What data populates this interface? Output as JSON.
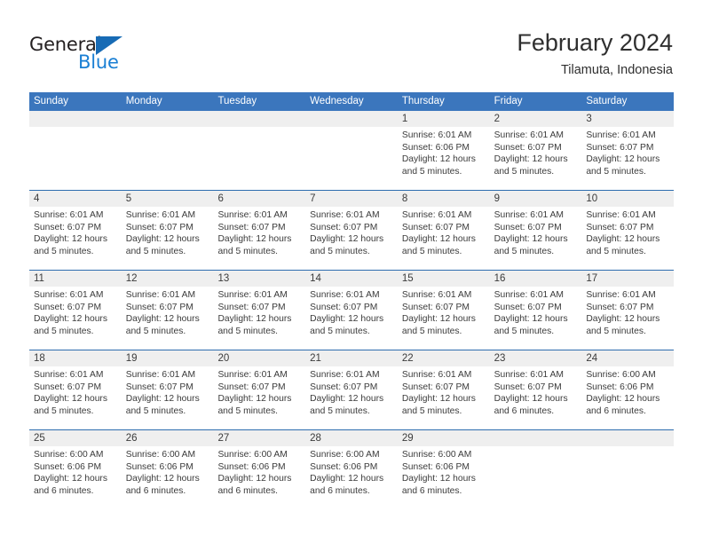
{
  "brand": {
    "name_part1": "General",
    "name_part2": "Blue"
  },
  "header": {
    "title": "February 2024",
    "subtitle": "Tilamuta, Indonesia"
  },
  "colors": {
    "header_blue": "#3b76bd",
    "separator_blue": "#2e6daf",
    "daynum_band": "#efefef",
    "logo_blue": "#1a7fd4",
    "text": "#3b3b3b"
  },
  "weekdays": [
    "Sunday",
    "Monday",
    "Tuesday",
    "Wednesday",
    "Thursday",
    "Friday",
    "Saturday"
  ],
  "weeks": [
    [
      {
        "day": "",
        "lines": [
          "",
          "",
          "",
          ""
        ]
      },
      {
        "day": "",
        "lines": [
          "",
          "",
          "",
          ""
        ]
      },
      {
        "day": "",
        "lines": [
          "",
          "",
          "",
          ""
        ]
      },
      {
        "day": "",
        "lines": [
          "",
          "",
          "",
          ""
        ]
      },
      {
        "day": "1",
        "lines": [
          "Sunrise: 6:01 AM",
          "Sunset: 6:06 PM",
          "Daylight: 12 hours",
          "and 5 minutes."
        ]
      },
      {
        "day": "2",
        "lines": [
          "Sunrise: 6:01 AM",
          "Sunset: 6:07 PM",
          "Daylight: 12 hours",
          "and 5 minutes."
        ]
      },
      {
        "day": "3",
        "lines": [
          "Sunrise: 6:01 AM",
          "Sunset: 6:07 PM",
          "Daylight: 12 hours",
          "and 5 minutes."
        ]
      }
    ],
    [
      {
        "day": "4",
        "lines": [
          "Sunrise: 6:01 AM",
          "Sunset: 6:07 PM",
          "Daylight: 12 hours",
          "and 5 minutes."
        ]
      },
      {
        "day": "5",
        "lines": [
          "Sunrise: 6:01 AM",
          "Sunset: 6:07 PM",
          "Daylight: 12 hours",
          "and 5 minutes."
        ]
      },
      {
        "day": "6",
        "lines": [
          "Sunrise: 6:01 AM",
          "Sunset: 6:07 PM",
          "Daylight: 12 hours",
          "and 5 minutes."
        ]
      },
      {
        "day": "7",
        "lines": [
          "Sunrise: 6:01 AM",
          "Sunset: 6:07 PM",
          "Daylight: 12 hours",
          "and 5 minutes."
        ]
      },
      {
        "day": "8",
        "lines": [
          "Sunrise: 6:01 AM",
          "Sunset: 6:07 PM",
          "Daylight: 12 hours",
          "and 5 minutes."
        ]
      },
      {
        "day": "9",
        "lines": [
          "Sunrise: 6:01 AM",
          "Sunset: 6:07 PM",
          "Daylight: 12 hours",
          "and 5 minutes."
        ]
      },
      {
        "day": "10",
        "lines": [
          "Sunrise: 6:01 AM",
          "Sunset: 6:07 PM",
          "Daylight: 12 hours",
          "and 5 minutes."
        ]
      }
    ],
    [
      {
        "day": "11",
        "lines": [
          "Sunrise: 6:01 AM",
          "Sunset: 6:07 PM",
          "Daylight: 12 hours",
          "and 5 minutes."
        ]
      },
      {
        "day": "12",
        "lines": [
          "Sunrise: 6:01 AM",
          "Sunset: 6:07 PM",
          "Daylight: 12 hours",
          "and 5 minutes."
        ]
      },
      {
        "day": "13",
        "lines": [
          "Sunrise: 6:01 AM",
          "Sunset: 6:07 PM",
          "Daylight: 12 hours",
          "and 5 minutes."
        ]
      },
      {
        "day": "14",
        "lines": [
          "Sunrise: 6:01 AM",
          "Sunset: 6:07 PM",
          "Daylight: 12 hours",
          "and 5 minutes."
        ]
      },
      {
        "day": "15",
        "lines": [
          "Sunrise: 6:01 AM",
          "Sunset: 6:07 PM",
          "Daylight: 12 hours",
          "and 5 minutes."
        ]
      },
      {
        "day": "16",
        "lines": [
          "Sunrise: 6:01 AM",
          "Sunset: 6:07 PM",
          "Daylight: 12 hours",
          "and 5 minutes."
        ]
      },
      {
        "day": "17",
        "lines": [
          "Sunrise: 6:01 AM",
          "Sunset: 6:07 PM",
          "Daylight: 12 hours",
          "and 5 minutes."
        ]
      }
    ],
    [
      {
        "day": "18",
        "lines": [
          "Sunrise: 6:01 AM",
          "Sunset: 6:07 PM",
          "Daylight: 12 hours",
          "and 5 minutes."
        ]
      },
      {
        "day": "19",
        "lines": [
          "Sunrise: 6:01 AM",
          "Sunset: 6:07 PM",
          "Daylight: 12 hours",
          "and 5 minutes."
        ]
      },
      {
        "day": "20",
        "lines": [
          "Sunrise: 6:01 AM",
          "Sunset: 6:07 PM",
          "Daylight: 12 hours",
          "and 5 minutes."
        ]
      },
      {
        "day": "21",
        "lines": [
          "Sunrise: 6:01 AM",
          "Sunset: 6:07 PM",
          "Daylight: 12 hours",
          "and 5 minutes."
        ]
      },
      {
        "day": "22",
        "lines": [
          "Sunrise: 6:01 AM",
          "Sunset: 6:07 PM",
          "Daylight: 12 hours",
          "and 5 minutes."
        ]
      },
      {
        "day": "23",
        "lines": [
          "Sunrise: 6:01 AM",
          "Sunset: 6:07 PM",
          "Daylight: 12 hours",
          "and 6 minutes."
        ]
      },
      {
        "day": "24",
        "lines": [
          "Sunrise: 6:00 AM",
          "Sunset: 6:06 PM",
          "Daylight: 12 hours",
          "and 6 minutes."
        ]
      }
    ],
    [
      {
        "day": "25",
        "lines": [
          "Sunrise: 6:00 AM",
          "Sunset: 6:06 PM",
          "Daylight: 12 hours",
          "and 6 minutes."
        ]
      },
      {
        "day": "26",
        "lines": [
          "Sunrise: 6:00 AM",
          "Sunset: 6:06 PM",
          "Daylight: 12 hours",
          "and 6 minutes."
        ]
      },
      {
        "day": "27",
        "lines": [
          "Sunrise: 6:00 AM",
          "Sunset: 6:06 PM",
          "Daylight: 12 hours",
          "and 6 minutes."
        ]
      },
      {
        "day": "28",
        "lines": [
          "Sunrise: 6:00 AM",
          "Sunset: 6:06 PM",
          "Daylight: 12 hours",
          "and 6 minutes."
        ]
      },
      {
        "day": "29",
        "lines": [
          "Sunrise: 6:00 AM",
          "Sunset: 6:06 PM",
          "Daylight: 12 hours",
          "and 6 minutes."
        ]
      },
      {
        "day": "",
        "lines": [
          "",
          "",
          "",
          ""
        ]
      },
      {
        "day": "",
        "lines": [
          "",
          "",
          "",
          ""
        ]
      }
    ]
  ]
}
